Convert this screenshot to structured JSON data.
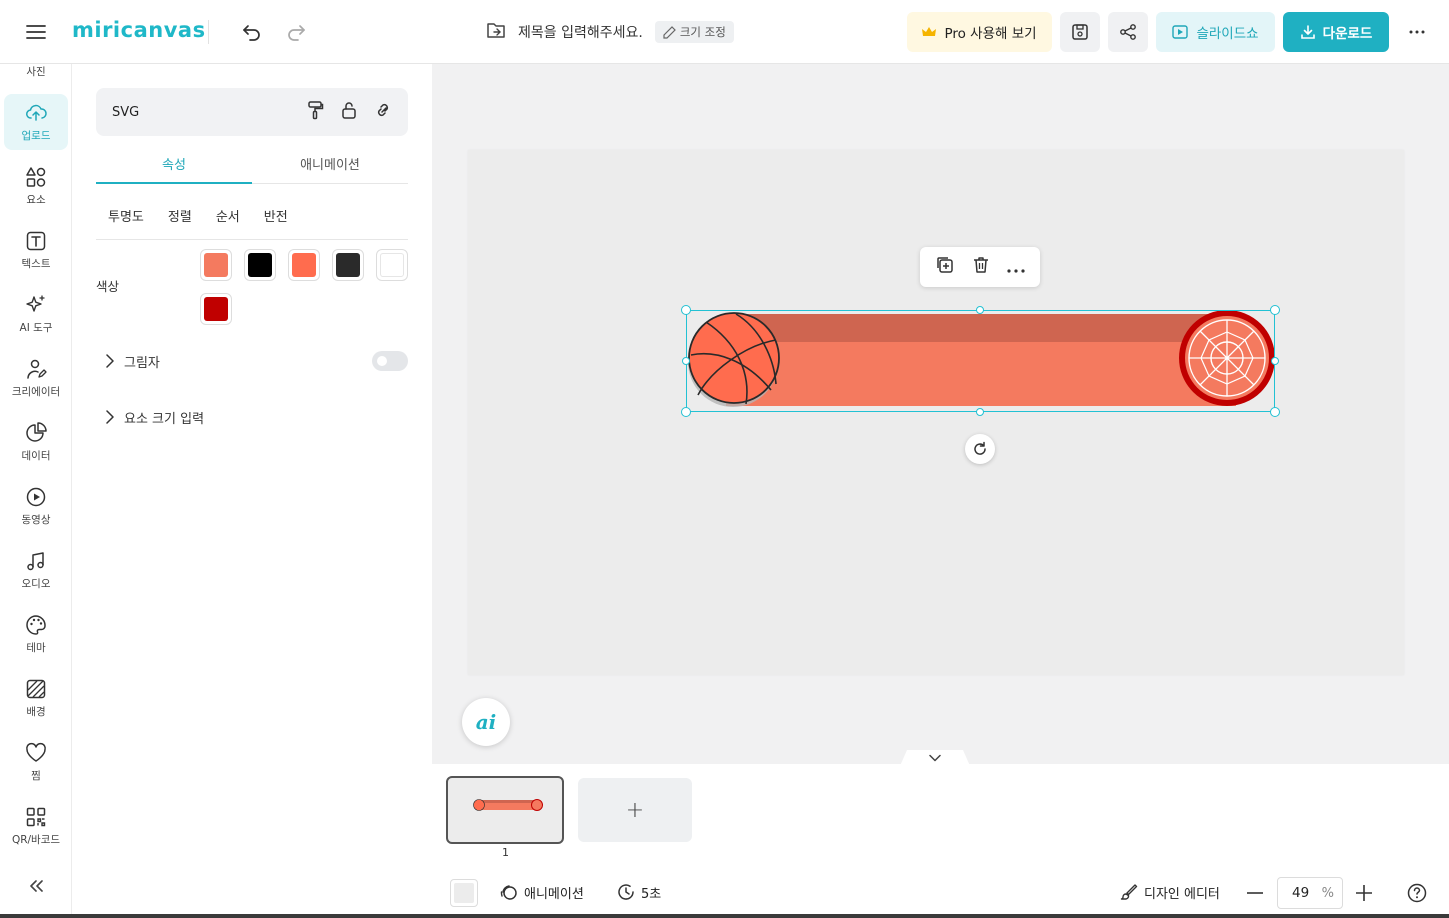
{
  "app": {
    "logo": "miricanvas",
    "title_placeholder": "제목을 입력해주세요.",
    "resize_label": "크기 조정",
    "pro_label": "Pro 사용해 보기",
    "slideshow_label": "슬라이드쇼",
    "download_label": "다운로드"
  },
  "rail": {
    "items": [
      {
        "label": "사진"
      },
      {
        "label": "업로드"
      },
      {
        "label": "요소"
      },
      {
        "label": "텍스트"
      },
      {
        "label": "AI 도구"
      },
      {
        "label": "크리에이터"
      },
      {
        "label": "데이터"
      },
      {
        "label": "동영상"
      },
      {
        "label": "오디오"
      },
      {
        "label": "테마"
      },
      {
        "label": "배경"
      },
      {
        "label": "찜"
      },
      {
        "label": "QR/바코드"
      }
    ]
  },
  "panel": {
    "element_type": "SVG",
    "tabs": [
      "속성",
      "애니메이션"
    ],
    "subtabs": [
      "투명도",
      "정렬",
      "순서",
      "반전"
    ],
    "color_label": "색상",
    "colors": [
      "#f47a5f",
      "#000000",
      "#ff6c4e",
      "#2a2a2a",
      "#ffffff",
      "#c00000"
    ],
    "shadow_label": "그림자",
    "size_label": "요소 크기 입력"
  },
  "pages": {
    "current": "1",
    "add_label": "+"
  },
  "bottom": {
    "animation_label": "애니메이션",
    "duration_label": "5초",
    "design_editor_label": "디자인 에디터",
    "zoom_value": "49",
    "zoom_unit": "%"
  },
  "colors": {
    "accent": "#1fb0c2",
    "bar_fill": "#f47a5f",
    "bar_top": "#cf6550",
    "hoop_red": "#c00000"
  }
}
